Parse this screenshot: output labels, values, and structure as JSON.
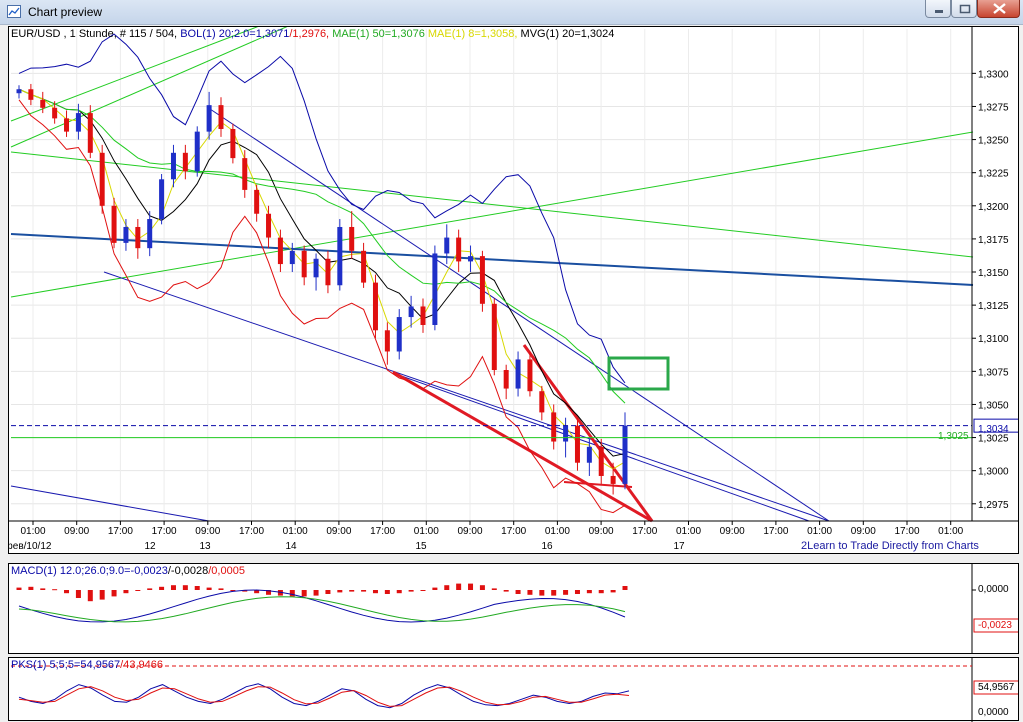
{
  "window": {
    "title": "Chart preview"
  },
  "legend": {
    "symbol": "EUR/USD , 1 Stunde, # 115 / 504,",
    "bol": "BOL(1) 20;2.0=1,3071",
    "bol_low": "/1,2976,",
    "mae": "MAE(1) 50=1,3076",
    "mae2": "MAE(1) 8=1,3058,",
    "mvg": "MVG(1) 20=1,3024"
  },
  "price_panel": {
    "ylim": [
      1.2962,
      1.3335
    ],
    "y_ticks": [
      "1,3300",
      "1,3275",
      "1,3250",
      "1,3225",
      "1,3200",
      "1,3175",
      "1,3150",
      "1,3125",
      "1,3100",
      "1,3075",
      "1,3050",
      "1,3025",
      "1,3000",
      "1,2975"
    ],
    "last_price_label": "1,3034",
    "level_label": "1,3025",
    "last_price": 1.3034,
    "level": 1.3025
  },
  "x_axis": {
    "time_labels": [
      "01:00",
      "09:00",
      "17:00",
      "17:00",
      "09:00",
      "17:00",
      "01:00",
      "09:00",
      "17:00",
      "01:00",
      "09:00",
      "17:00",
      "01:00",
      "09:00",
      "17:00",
      "01:00",
      "09:00",
      "17:00",
      "01:00",
      "09:00",
      "17:00",
      "01:00"
    ],
    "date_labels": [
      "фев/10/12",
      "12",
      "13",
      "14",
      "15",
      "16",
      "17"
    ],
    "link": "Learn to Trade Directly from Charts",
    "link_prefix": "2"
  },
  "macd_panel": {
    "legend_name": "MACD(1) 12.0;26.0;9.0=",
    "legend_v1": "-0,0023",
    "legend_v2": "/-0,0028",
    "legend_v3": "/0,0005",
    "y_tick": "0,0000",
    "value_label": "-0,0023"
  },
  "pks_panel": {
    "legend_name": "PKS(1) 5;5;5=",
    "legend_v1": "54,9567",
    "legend_v2": "/43,9466",
    "value_label": "54,9567",
    "y_tick": "0,0000"
  },
  "colors": {
    "bull": "#1f2fc8",
    "bear": "#e01010",
    "band": "#0a0aa8",
    "green": "#22cc22",
    "yellow": "#d8d800",
    "annotation_box": "#2aa84a"
  },
  "chart_data": [
    {
      "type": "candlestick",
      "title": "EUR/USD , 1 Stunde",
      "ylim": [
        1.2962,
        1.3335
      ],
      "ohlc": [
        [
          1.3285,
          1.3291,
          1.3281,
          1.3288
        ],
        [
          1.3288,
          1.3292,
          1.3276,
          1.328
        ],
        [
          1.328,
          1.3286,
          1.327,
          1.3274
        ],
        [
          1.3274,
          1.3279,
          1.3262,
          1.3266
        ],
        [
          1.3266,
          1.3272,
          1.3252,
          1.3256
        ],
        [
          1.3256,
          1.3277,
          1.325,
          1.327
        ],
        [
          1.327,
          1.3276,
          1.3236,
          1.324
        ],
        [
          1.324,
          1.3246,
          1.3194,
          1.32
        ],
        [
          1.32,
          1.3206,
          1.3168,
          1.3172
        ],
        [
          1.3172,
          1.319,
          1.3166,
          1.3184
        ],
        [
          1.3184,
          1.319,
          1.316,
          1.3168
        ],
        [
          1.3168,
          1.3196,
          1.3162,
          1.319
        ],
        [
          1.319,
          1.3224,
          1.3186,
          1.322
        ],
        [
          1.322,
          1.3246,
          1.3214,
          1.324
        ],
        [
          1.324,
          1.3246,
          1.322,
          1.3226
        ],
        [
          1.3226,
          1.326,
          1.3222,
          1.3256
        ],
        [
          1.3256,
          1.3286,
          1.325,
          1.3276
        ],
        [
          1.3276,
          1.3282,
          1.3252,
          1.3258
        ],
        [
          1.3258,
          1.3262,
          1.3232,
          1.3236
        ],
        [
          1.3236,
          1.3242,
          1.3206,
          1.3212
        ],
        [
          1.3212,
          1.3216,
          1.3188,
          1.3194
        ],
        [
          1.3194,
          1.32,
          1.3168,
          1.3176
        ],
        [
          1.3176,
          1.3182,
          1.315,
          1.3156
        ],
        [
          1.3156,
          1.3172,
          1.315,
          1.3166
        ],
        [
          1.3166,
          1.317,
          1.314,
          1.3146
        ],
        [
          1.3146,
          1.3164,
          1.3136,
          1.316
        ],
        [
          1.316,
          1.3166,
          1.3134,
          1.314
        ],
        [
          1.314,
          1.319,
          1.3136,
          1.3184
        ],
        [
          1.3184,
          1.3196,
          1.316,
          1.3166
        ],
        [
          1.3166,
          1.3172,
          1.3138,
          1.3142
        ],
        [
          1.3142,
          1.3148,
          1.31,
          1.3106
        ],
        [
          1.3106,
          1.3112,
          1.308,
          1.309
        ],
        [
          1.309,
          1.3122,
          1.3084,
          1.3116
        ],
        [
          1.3116,
          1.3132,
          1.3108,
          1.3124
        ],
        [
          1.3124,
          1.313,
          1.3104,
          1.311
        ],
        [
          1.311,
          1.317,
          1.3106,
          1.3164
        ],
        [
          1.3164,
          1.3186,
          1.3156,
          1.3176
        ],
        [
          1.3176,
          1.3182,
          1.315,
          1.3158
        ],
        [
          1.3158,
          1.317,
          1.315,
          1.3162
        ],
        [
          1.3162,
          1.3166,
          1.312,
          1.3126
        ],
        [
          1.3126,
          1.313,
          1.3072,
          1.3076
        ],
        [
          1.3076,
          1.308,
          1.3054,
          1.3062
        ],
        [
          1.3062,
          1.309,
          1.3056,
          1.3084
        ],
        [
          1.3084,
          1.309,
          1.3056,
          1.306
        ],
        [
          1.306,
          1.3064,
          1.3038,
          1.3044
        ],
        [
          1.3044,
          1.305,
          1.3016,
          1.3022
        ],
        [
          1.3022,
          1.304,
          1.301,
          1.3034
        ],
        [
          1.3034,
          1.304,
          1.3,
          1.3006
        ],
        [
          1.3006,
          1.3024,
          1.2996,
          1.3018
        ],
        [
          1.3018,
          1.3024,
          1.299,
          1.2996
        ],
        [
          1.2996,
          1.3006,
          1.2982,
          1.299
        ],
        [
          1.299,
          1.3044,
          1.2986,
          1.3034
        ]
      ]
    },
    {
      "type": "bar",
      "title": "MACD(1) 12.0;26.0;9.0",
      "values": [
        0.0003,
        0.0004,
        0.0002,
        0.0001,
        -0.0004,
        -0.001,
        -0.0014,
        -0.0012,
        -0.0008,
        -0.0004,
        -0.0001,
        0.0002,
        0.0004,
        0.0006,
        0.0006,
        0.0005,
        0.0003,
        0.0002,
        0.0,
        -0.0002,
        -0.0004,
        -0.0006,
        -0.0007,
        -0.0008,
        -0.0008,
        -0.0007,
        -0.0005,
        -0.0003,
        -0.0002,
        -0.0002,
        -0.0004,
        -0.0005,
        -0.0004,
        -0.0002,
        0.0,
        0.0003,
        0.0006,
        0.0008,
        0.0008,
        0.0006,
        0.0002,
        -0.0002,
        -0.0005,
        -0.0006,
        -0.0007,
        -0.0007,
        -0.0006,
        -0.0005,
        -0.0004,
        -0.0004,
        -0.0003,
        0.0005
      ]
    },
    {
      "type": "line",
      "title": "PKS(1) 5;5;5",
      "series": [
        {
          "name": "54,9567",
          "values": [
            40,
            30,
            25,
            35,
            55,
            70,
            62,
            45,
            30,
            28,
            40,
            60,
            70,
            55,
            40,
            30,
            25,
            35,
            50,
            65,
            72,
            60,
            40,
            25,
            20,
            30,
            45,
            60,
            55,
            35,
            20,
            15,
            25,
            45,
            60,
            70,
            62,
            45,
            30,
            22,
            20,
            25,
            35,
            45,
            40,
            30,
            25,
            30,
            42,
            50,
            48,
            55
          ]
        },
        {
          "name": "43,9466",
          "values": [
            35,
            32,
            28,
            30,
            45,
            60,
            65,
            55,
            40,
            32,
            35,
            50,
            62,
            60,
            48,
            36,
            28,
            30,
            42,
            55,
            65,
            64,
            50,
            34,
            24,
            26,
            38,
            52,
            56,
            44,
            28,
            18,
            20,
            35,
            50,
            62,
            64,
            54,
            40,
            28,
            22,
            23,
            30,
            40,
            42,
            35,
            28,
            28,
            36,
            45,
            47,
            44
          ]
        }
      ]
    }
  ]
}
